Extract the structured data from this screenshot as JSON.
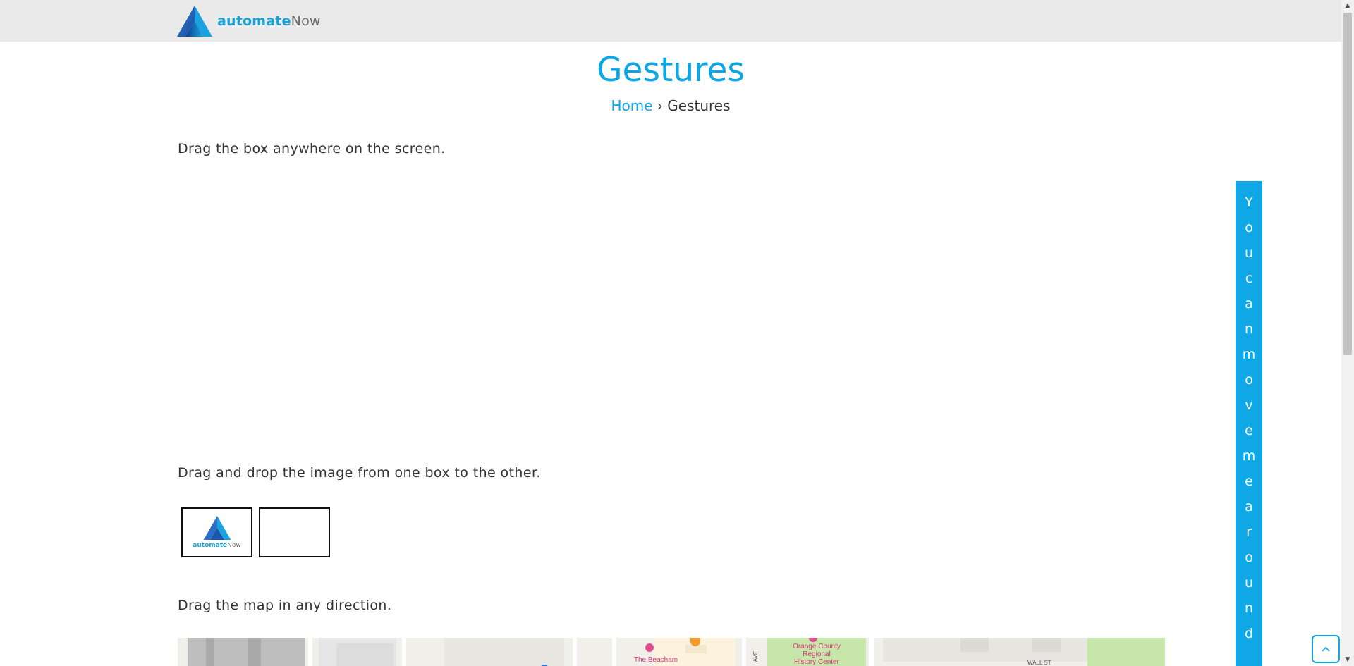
{
  "header": {
    "logo_bold": "automate",
    "logo_light": "Now"
  },
  "page": {
    "title": "Gestures",
    "breadcrumb_home": "Home",
    "breadcrumb_sep": "›",
    "breadcrumb_current": "Gestures"
  },
  "sections": {
    "drag_box_instruction": "Drag the box anywhere on the screen.",
    "drag_drop_instruction": "Drag and drop the image from one box to the other.",
    "drag_map_instruction": "Drag the map in any direction."
  },
  "moveable_box": {
    "letters": [
      "Y",
      "o",
      "u",
      "c",
      "a",
      "n",
      "m",
      "o",
      "v",
      "e",
      "m",
      "e",
      "a",
      "r",
      "o",
      "u",
      "n",
      "d"
    ]
  },
  "drop_image": {
    "logo_bold": "automate",
    "logo_light": "Now"
  },
  "map": {
    "poi_1": "The Beacham",
    "poi_2_line1": "Orange County",
    "poi_2_line2": "Regional",
    "poi_2_line3": "History Center",
    "street_1": "WALL ST",
    "street_2": "AVE"
  },
  "colors": {
    "accent": "#0aa6e6",
    "topbar": "#eaeaea",
    "moveable": "#10a7e7"
  },
  "icons": {
    "back_to_top": "chevron-up-icon",
    "logo": "automatenow-logo-icon"
  }
}
